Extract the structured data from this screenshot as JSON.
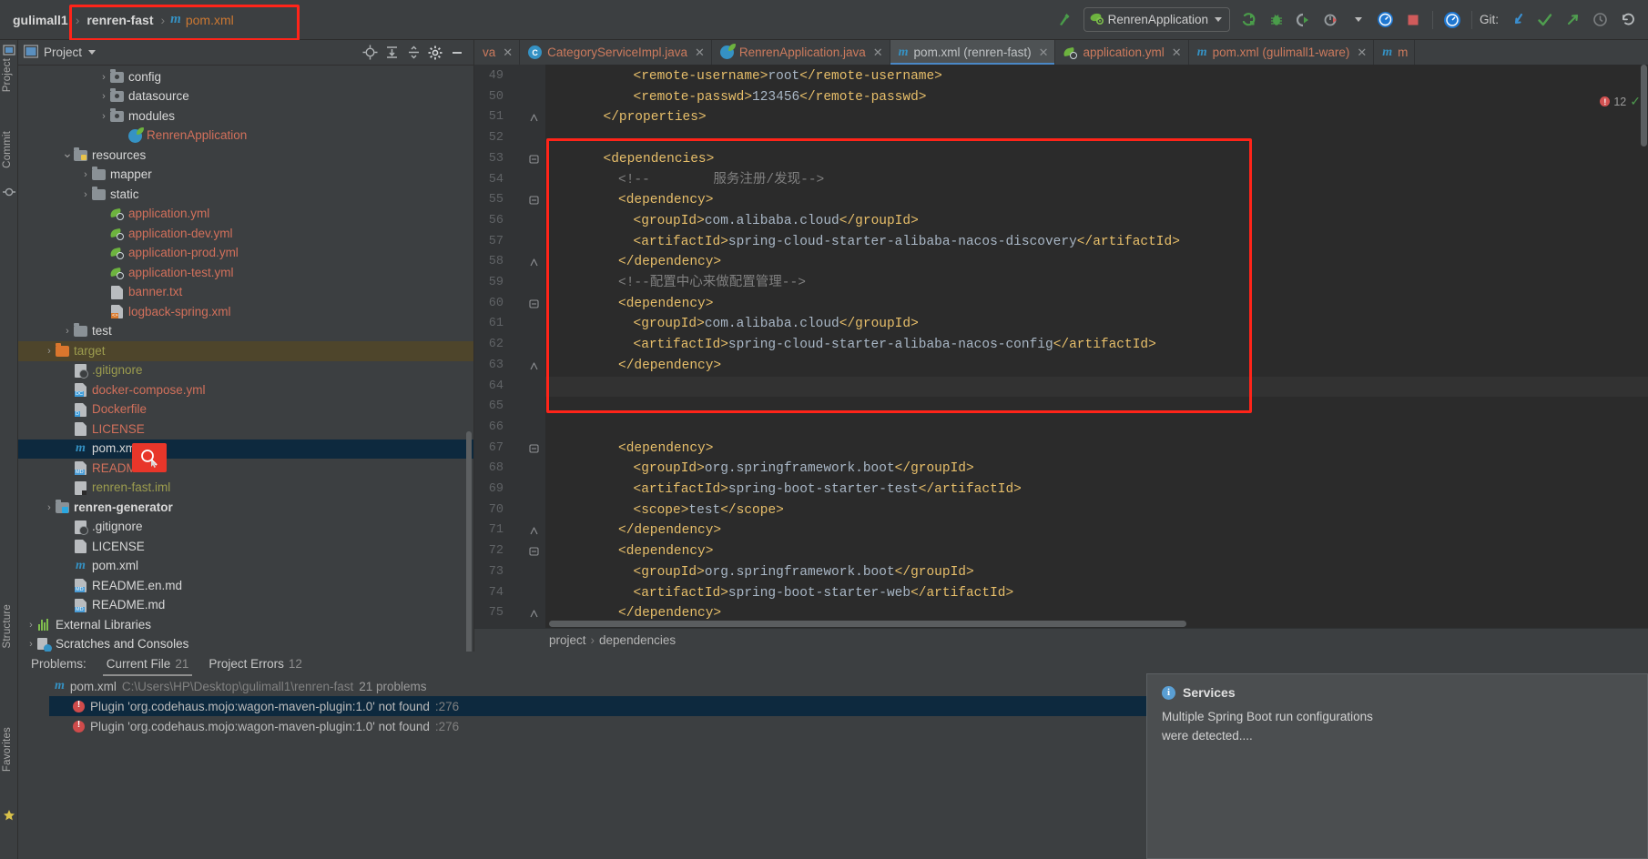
{
  "breadcrumb": {
    "project": "gulimall1",
    "module": "renren-fast",
    "file": "pom.xml",
    "separator": "›"
  },
  "toolbar": {
    "run_config": "RenrenApplication",
    "git_label": "Git:",
    "icons": {
      "build": "hammer-icon",
      "run": "run-icon",
      "debug": "debug-icon",
      "run_with_coverage": "run-coverage-icon",
      "profile": "profiler-icon",
      "stop": "stop-icon",
      "search_everywhere": "search-everywhere-icon",
      "update_project": "git-update-icon",
      "commit": "git-commit-icon",
      "push": "git-push-icon",
      "history": "git-history-icon",
      "rollback": "git-rollback-icon"
    }
  },
  "left_stripe": {
    "project": "Project",
    "commit": "Commit",
    "structure": "Structure",
    "favorites": "Favorites"
  },
  "project_panel": {
    "title": "Project",
    "tools": [
      "locate-icon",
      "expand-all-icon",
      "collapse-all-icon",
      "settings-gear-icon",
      "hide-icon"
    ],
    "tree": [
      {
        "label": "config",
        "indent": 4,
        "arrow": "›",
        "icon": "folder-package",
        "color": "c-white"
      },
      {
        "label": "datasource",
        "indent": 4,
        "arrow": "›",
        "icon": "folder-package",
        "color": "c-white"
      },
      {
        "label": "modules",
        "indent": 4,
        "arrow": "›",
        "icon": "folder-package",
        "color": "c-white"
      },
      {
        "label": "RenrenApplication",
        "indent": 5,
        "arrow": "",
        "icon": "spring-class",
        "color": "c-redbright"
      },
      {
        "label": "resources",
        "indent": 2,
        "arrow": "⌄",
        "icon": "folder-resources",
        "color": "c-white"
      },
      {
        "label": "mapper",
        "indent": 3,
        "arrow": "›",
        "icon": "folder",
        "color": "c-white"
      },
      {
        "label": "static",
        "indent": 3,
        "arrow": "›",
        "icon": "folder",
        "color": "c-white"
      },
      {
        "label": "application.yml",
        "indent": 4,
        "arrow": "",
        "icon": "spring-yml",
        "color": "c-redbright"
      },
      {
        "label": "application-dev.yml",
        "indent": 4,
        "arrow": "",
        "icon": "spring-yml",
        "color": "c-redbright"
      },
      {
        "label": "application-prod.yml",
        "indent": 4,
        "arrow": "",
        "icon": "spring-yml",
        "color": "c-redbright"
      },
      {
        "label": "application-test.yml",
        "indent": 4,
        "arrow": "",
        "icon": "spring-yml",
        "color": "c-redbright"
      },
      {
        "label": "banner.txt",
        "indent": 4,
        "arrow": "",
        "icon": "file-txt",
        "color": "c-redbright"
      },
      {
        "label": "logback-spring.xml",
        "indent": 4,
        "arrow": "",
        "icon": "file-xml",
        "color": "c-redbright"
      },
      {
        "label": "test",
        "indent": 2,
        "arrow": "›",
        "icon": "folder",
        "color": "c-white"
      },
      {
        "label": "target",
        "indent": 1,
        "arrow": "›",
        "icon": "folder-orange",
        "color": "c-olive",
        "row": "sel-target"
      },
      {
        "label": ".gitignore",
        "indent": 2,
        "arrow": "",
        "icon": "file-gitignore",
        "color": "c-olive"
      },
      {
        "label": "docker-compose.yml",
        "indent": 2,
        "arrow": "",
        "icon": "file-dc",
        "color": "c-redbright"
      },
      {
        "label": "Dockerfile",
        "indent": 2,
        "arrow": "",
        "icon": "file-docker",
        "color": "c-redbright"
      },
      {
        "label": "LICENSE",
        "indent": 2,
        "arrow": "",
        "icon": "file-plain",
        "color": "c-redbright"
      },
      {
        "label": "pom.xml",
        "indent": 2,
        "arrow": "",
        "icon": "maven",
        "color": "c-white",
        "row": "sel-blue"
      },
      {
        "label": "README.md",
        "indent": 2,
        "arrow": "",
        "icon": "file-md",
        "color": "c-redbright"
      },
      {
        "label": "renren-fast.iml",
        "indent": 2,
        "arrow": "",
        "icon": "file-iml",
        "color": "c-olive"
      },
      {
        "label": "renren-generator",
        "indent": 1,
        "arrow": "›",
        "icon": "folder-module",
        "color": "c-bold"
      },
      {
        "label": ".gitignore",
        "indent": 2,
        "arrow": "",
        "icon": "file-gitignore",
        "color": "c-white"
      },
      {
        "label": "LICENSE",
        "indent": 2,
        "arrow": "",
        "icon": "file-plain",
        "color": "c-white"
      },
      {
        "label": "pom.xml",
        "indent": 2,
        "arrow": "",
        "icon": "maven",
        "color": "c-white"
      },
      {
        "label": "README.en.md",
        "indent": 2,
        "arrow": "",
        "icon": "file-md",
        "color": "c-white"
      },
      {
        "label": "README.md",
        "indent": 2,
        "arrow": "",
        "icon": "file-md",
        "color": "c-white"
      },
      {
        "label": "External Libraries",
        "indent": 0,
        "arrow": "›",
        "icon": "libraries",
        "color": "c-white"
      },
      {
        "label": "Scratches and Consoles",
        "indent": 0,
        "arrow": "›",
        "icon": "scratches",
        "color": "c-white"
      }
    ]
  },
  "editor": {
    "tabs": [
      {
        "label": "va",
        "icon": "none",
        "active": false,
        "closable": true,
        "partial": true
      },
      {
        "label": "CategoryServiceImpl.java",
        "icon": "class-icon",
        "active": false,
        "closable": true
      },
      {
        "label": "RenrenApplication.java",
        "icon": "spring-class-icon",
        "active": false,
        "closable": true
      },
      {
        "label": "pom.xml (renren-fast)",
        "icon": "maven-icon",
        "active": true,
        "closable": true
      },
      {
        "label": "application.yml",
        "icon": "spring-yml-icon",
        "active": false,
        "closable": true
      },
      {
        "label": "pom.xml (gulimall1-ware)",
        "icon": "maven-icon",
        "active": false,
        "closable": true
      },
      {
        "label": "m",
        "icon": "maven-icon",
        "active": false,
        "closable": false,
        "partial": true
      }
    ],
    "inspection": {
      "errors": "12",
      "error_badge": "!"
    },
    "first_line": 49,
    "lines": [
      {
        "n": 49,
        "indent": 5,
        "text": "<remote-username>root</remote-username>",
        "fold": ""
      },
      {
        "n": 50,
        "indent": 5,
        "text": "<remote-passwd>123456</remote-passwd>",
        "fold": ""
      },
      {
        "n": 51,
        "indent": 3,
        "text": "</properties>",
        "fold": "end"
      },
      {
        "n": 52,
        "indent": 0,
        "text": "",
        "fold": ""
      },
      {
        "n": 53,
        "indent": 3,
        "text": "<dependencies>",
        "fold": "start"
      },
      {
        "n": 54,
        "indent": 4,
        "text": "<!--        服务注册/发现-->",
        "fold": "",
        "comment": true
      },
      {
        "n": 55,
        "indent": 4,
        "text": "<dependency>",
        "fold": "start"
      },
      {
        "n": 56,
        "indent": 5,
        "text": "<groupId>com.alibaba.cloud</groupId>",
        "fold": ""
      },
      {
        "n": 57,
        "indent": 5,
        "text": "<artifactId>spring-cloud-starter-alibaba-nacos-discovery</artifactId>",
        "fold": ""
      },
      {
        "n": 58,
        "indent": 4,
        "text": "</dependency>",
        "fold": "end"
      },
      {
        "n": 59,
        "indent": 4,
        "text": "<!--配置中心来做配置管理-->",
        "fold": "",
        "comment": true
      },
      {
        "n": 60,
        "indent": 4,
        "text": "<dependency>",
        "fold": "start"
      },
      {
        "n": 61,
        "indent": 5,
        "text": "<groupId>com.alibaba.cloud</groupId>",
        "fold": ""
      },
      {
        "n": 62,
        "indent": 5,
        "text": "<artifactId>spring-cloud-starter-alibaba-nacos-config</artifactId>",
        "fold": ""
      },
      {
        "n": 63,
        "indent": 4,
        "text": "</dependency>",
        "fold": "end"
      },
      {
        "n": 64,
        "indent": 0,
        "text": "",
        "fold": "",
        "caret": true
      },
      {
        "n": 65,
        "indent": 0,
        "text": "",
        "fold": ""
      },
      {
        "n": 66,
        "indent": 0,
        "text": "",
        "fold": ""
      },
      {
        "n": 67,
        "indent": 4,
        "text": "<dependency>",
        "fold": "start"
      },
      {
        "n": 68,
        "indent": 5,
        "text": "<groupId>org.springframework.boot</groupId>",
        "fold": ""
      },
      {
        "n": 69,
        "indent": 5,
        "text": "<artifactId>spring-boot-starter-test</artifactId>",
        "fold": ""
      },
      {
        "n": 70,
        "indent": 5,
        "text": "<scope>test</scope>",
        "fold": ""
      },
      {
        "n": 71,
        "indent": 4,
        "text": "</dependency>",
        "fold": "end"
      },
      {
        "n": 72,
        "indent": 4,
        "text": "<dependency>",
        "fold": "start"
      },
      {
        "n": 73,
        "indent": 5,
        "text": "<groupId>org.springframework.boot</groupId>",
        "fold": ""
      },
      {
        "n": 74,
        "indent": 5,
        "text": "<artifactId>spring-boot-starter-web</artifactId>",
        "fold": ""
      },
      {
        "n": 75,
        "indent": 4,
        "text": "</dependency>",
        "fold": "end"
      }
    ],
    "breadcrumb_bottom": [
      "project",
      "dependencies"
    ]
  },
  "problems": {
    "label": "Problems:",
    "tabs": [
      {
        "label": "Current File",
        "count": "21",
        "selected": true
      },
      {
        "label": "Project Errors",
        "count": "12",
        "selected": false
      }
    ],
    "file_row": {
      "name": "pom.xml",
      "path": "C:\\Users\\HP\\Desktop\\gulimall1\\renren-fast",
      "count": "21 problems"
    },
    "items": [
      {
        "message": "Plugin 'org.codehaus.mojo:wagon-maven-plugin:1.0' not found",
        "line": ":276",
        "selected": true
      },
      {
        "message": "Plugin 'org.codehaus.mojo:wagon-maven-plugin:1.0' not found",
        "line": ":276",
        "selected": false
      }
    ]
  },
  "balloon": {
    "title": "Services",
    "line1": "Multiple Spring Boot run configurations",
    "line2": "were detected...."
  },
  "colors": {
    "accent_red": "#ff2419",
    "selection_blue": "#0d293e",
    "tab_active": "#4e5254",
    "editor_bg": "#2b2b2b",
    "panel_bg": "#3c3f41",
    "tag": "#e8bf6a",
    "comment": "#808080",
    "value": "#a9b7c6"
  }
}
